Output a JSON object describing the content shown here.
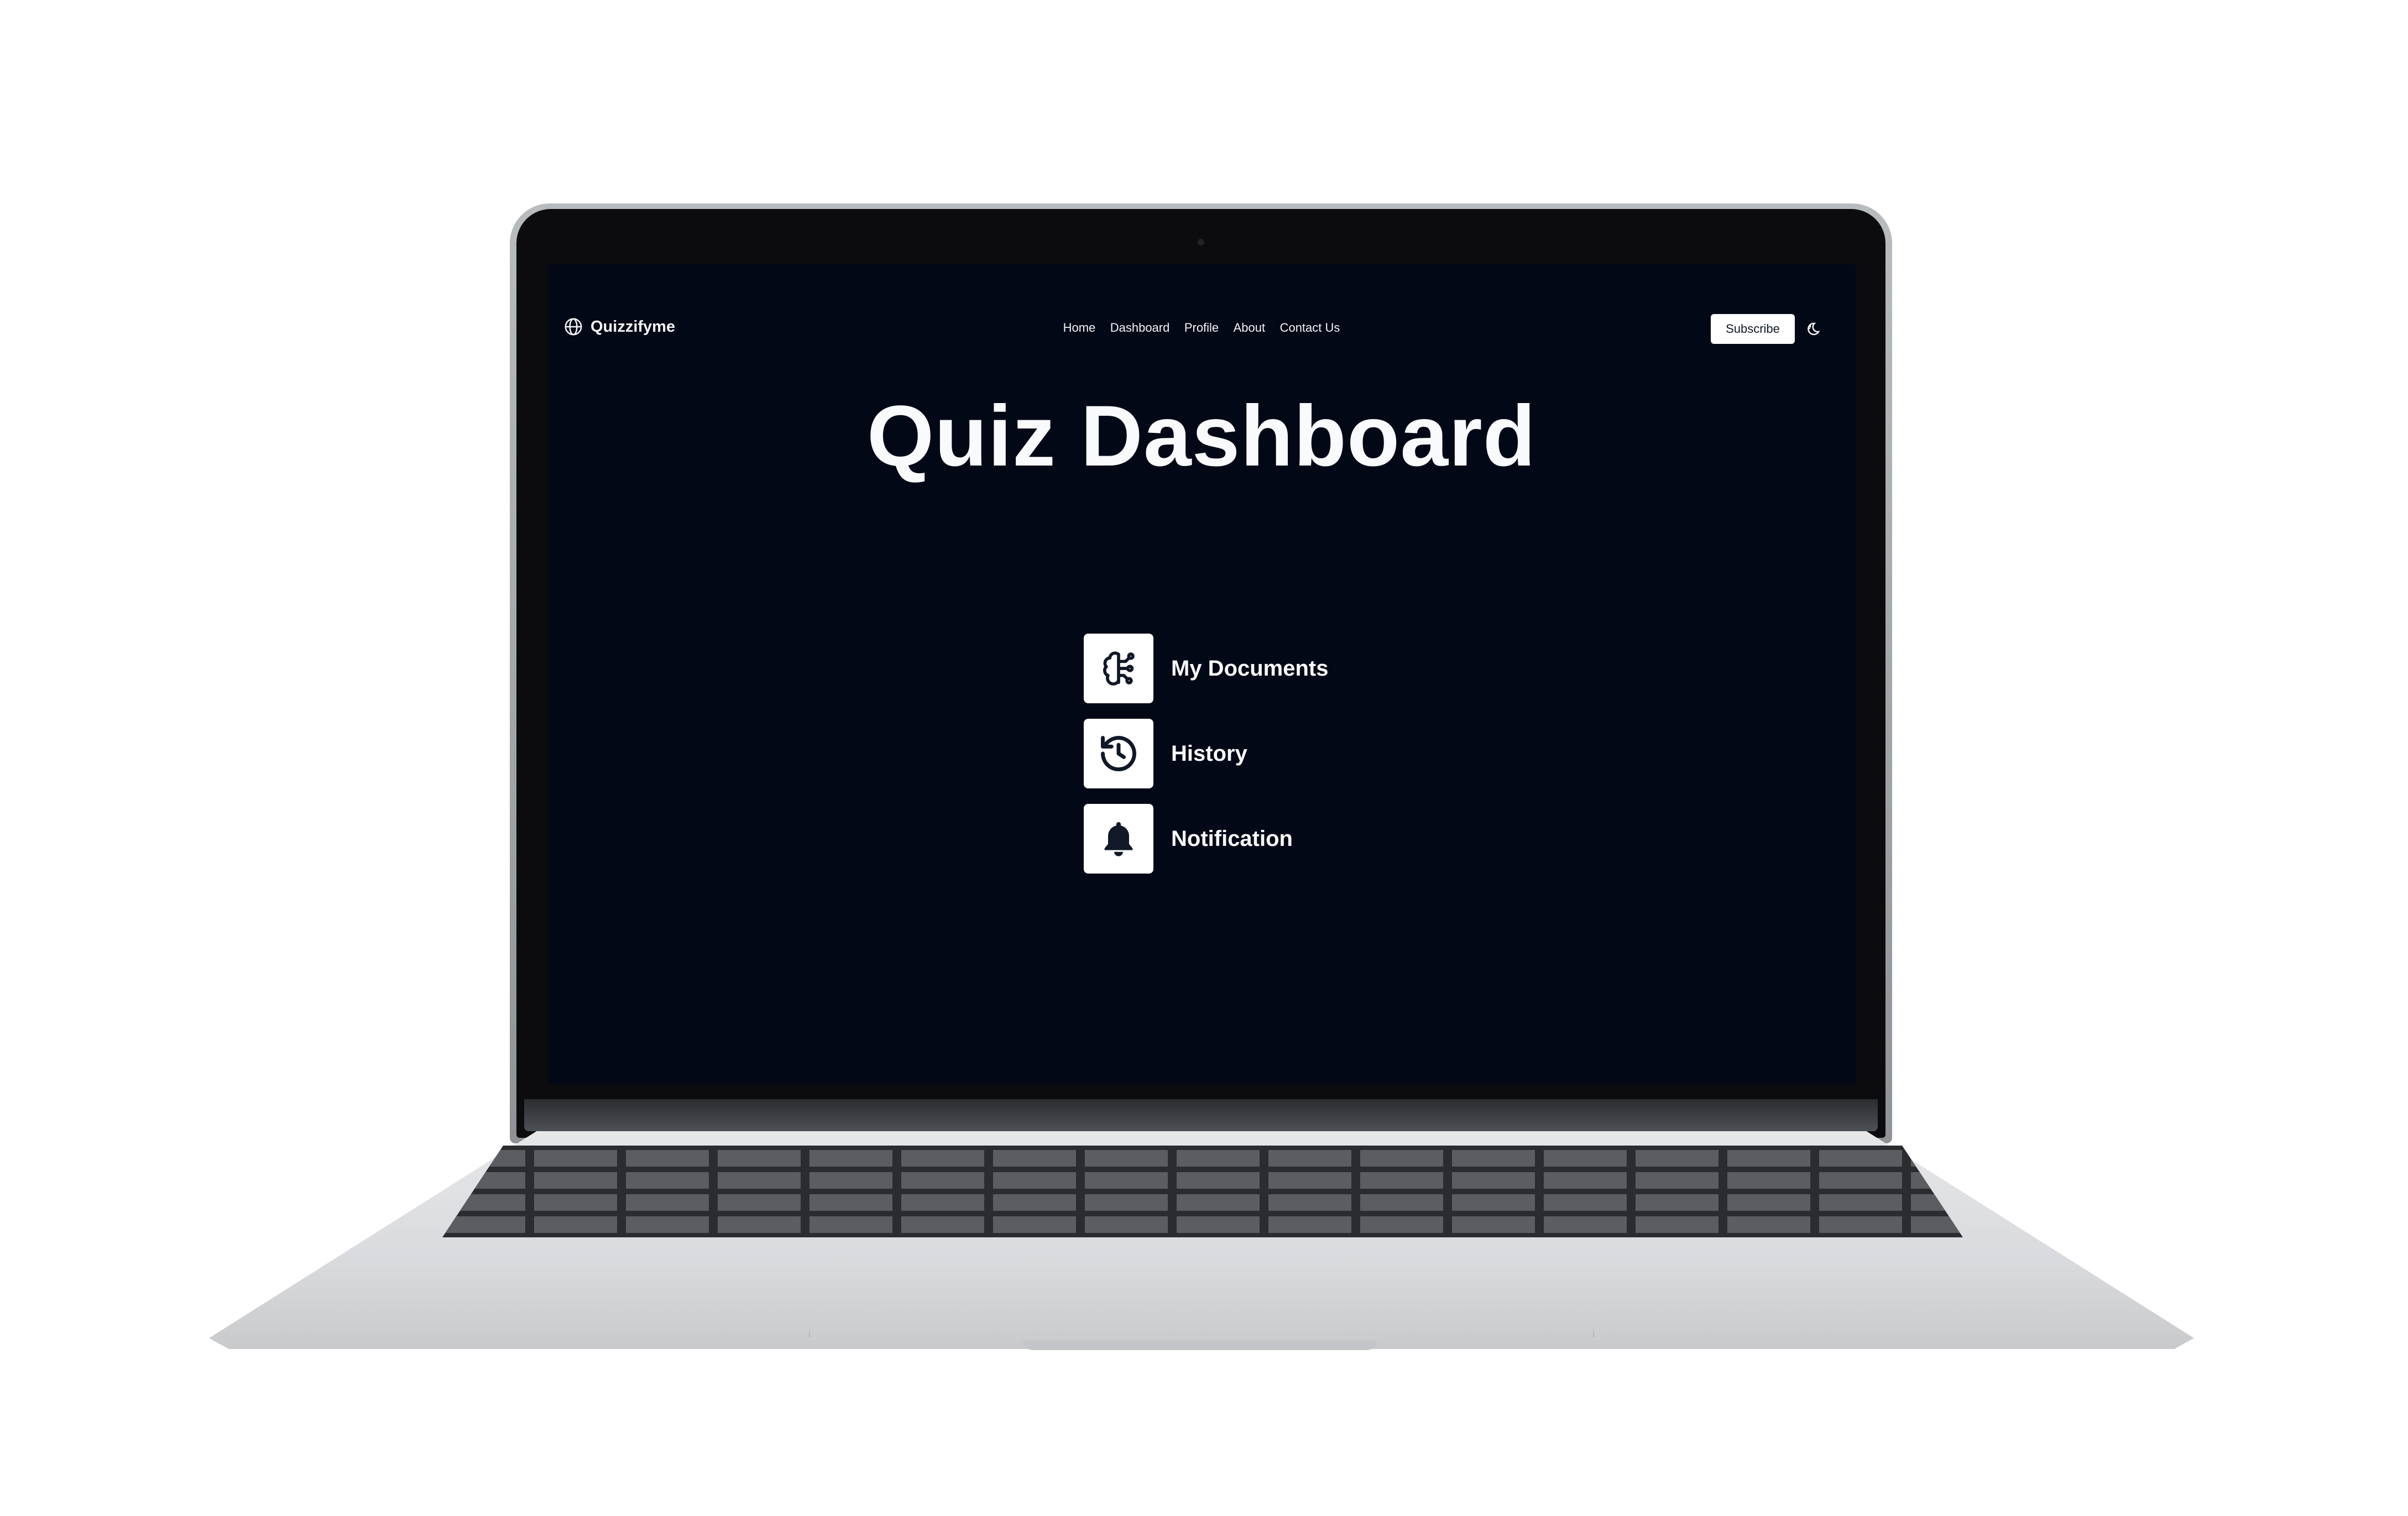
{
  "navbar": {
    "brand": "Quizzifyme",
    "links": [
      "Home",
      "Dashboard",
      "Profile",
      "About",
      "Contact Us"
    ],
    "subscribe_label": "Subscribe"
  },
  "page": {
    "title": "Quiz Dashboard"
  },
  "menu": {
    "items": [
      {
        "label": "My Documents",
        "icon": "brain-circuit-icon"
      },
      {
        "label": "History",
        "icon": "history-icon"
      },
      {
        "label": "Notification",
        "icon": "bell-icon"
      }
    ]
  },
  "colors": {
    "screen_background": "#030816",
    "text": "#f8fafc",
    "button_background": "#ffffff"
  }
}
